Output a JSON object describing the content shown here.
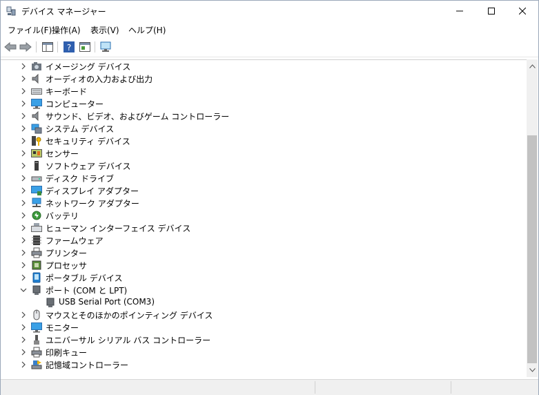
{
  "window": {
    "title": "デバイス マネージャー"
  },
  "menu": [
    "ファイル(F)",
    "操作(A)",
    "表示(V)",
    "ヘルプ(H)"
  ],
  "toolbar": {
    "buttons": [
      "back-icon",
      "forward-icon",
      "show-hide-tree-icon",
      "help-icon",
      "properties-icon",
      "scan-hardware-icon"
    ]
  },
  "tree": {
    "items": [
      {
        "label": "イメージング デバイス",
        "icon": "camera-icon",
        "expanded": false
      },
      {
        "label": "オーディオの入力および出力",
        "icon": "speaker-icon",
        "expanded": false
      },
      {
        "label": "キーボード",
        "icon": "keyboard-icon",
        "expanded": false
      },
      {
        "label": "コンピューター",
        "icon": "monitor-icon",
        "expanded": false
      },
      {
        "label": "サウンド、ビデオ、およびゲーム コントローラー",
        "icon": "speaker-icon",
        "expanded": false
      },
      {
        "label": "システム デバイス",
        "icon": "system-device-icon",
        "expanded": false
      },
      {
        "label": "セキュリティ デバイス",
        "icon": "security-key-icon",
        "expanded": false
      },
      {
        "label": "センサー",
        "icon": "sensor-icon",
        "expanded": false
      },
      {
        "label": "ソフトウェア デバイス",
        "icon": "software-device-icon",
        "expanded": false
      },
      {
        "label": "ディスク ドライブ",
        "icon": "disk-drive-icon",
        "expanded": false
      },
      {
        "label": "ディスプレイ アダプター",
        "icon": "display-adapter-icon",
        "expanded": false
      },
      {
        "label": "ネットワーク アダプター",
        "icon": "network-adapter-icon",
        "expanded": false
      },
      {
        "label": "バッテリ",
        "icon": "battery-icon",
        "expanded": false
      },
      {
        "label": "ヒューマン インターフェイス デバイス",
        "icon": "hid-icon",
        "expanded": false
      },
      {
        "label": "ファームウェア",
        "icon": "firmware-chip-icon",
        "expanded": false
      },
      {
        "label": "プリンター",
        "icon": "printer-icon",
        "expanded": false
      },
      {
        "label": "プロセッサ",
        "icon": "processor-icon",
        "expanded": false
      },
      {
        "label": "ポータブル デバイス",
        "icon": "portable-device-icon",
        "expanded": false
      },
      {
        "label": "ポート (COM と LPT)",
        "icon": "port-icon",
        "expanded": true
      },
      {
        "label": "USB Serial Port (COM3)",
        "icon": "port-icon",
        "child": true
      },
      {
        "label": "マウスとそのほかのポインティング デバイス",
        "icon": "mouse-icon",
        "expanded": false
      },
      {
        "label": "モニター",
        "icon": "monitor-icon",
        "expanded": false
      },
      {
        "label": "ユニバーサル シリアル バス コントローラー",
        "icon": "usb-icon",
        "expanded": false
      },
      {
        "label": "印刷キュー",
        "icon": "print-queue-icon",
        "expanded": false
      },
      {
        "label": "記憶域コントローラー",
        "icon": "storage-controller-icon",
        "expanded": false
      }
    ]
  },
  "colors": {
    "accent": "#0078d7",
    "selection": "#cce8ff"
  }
}
